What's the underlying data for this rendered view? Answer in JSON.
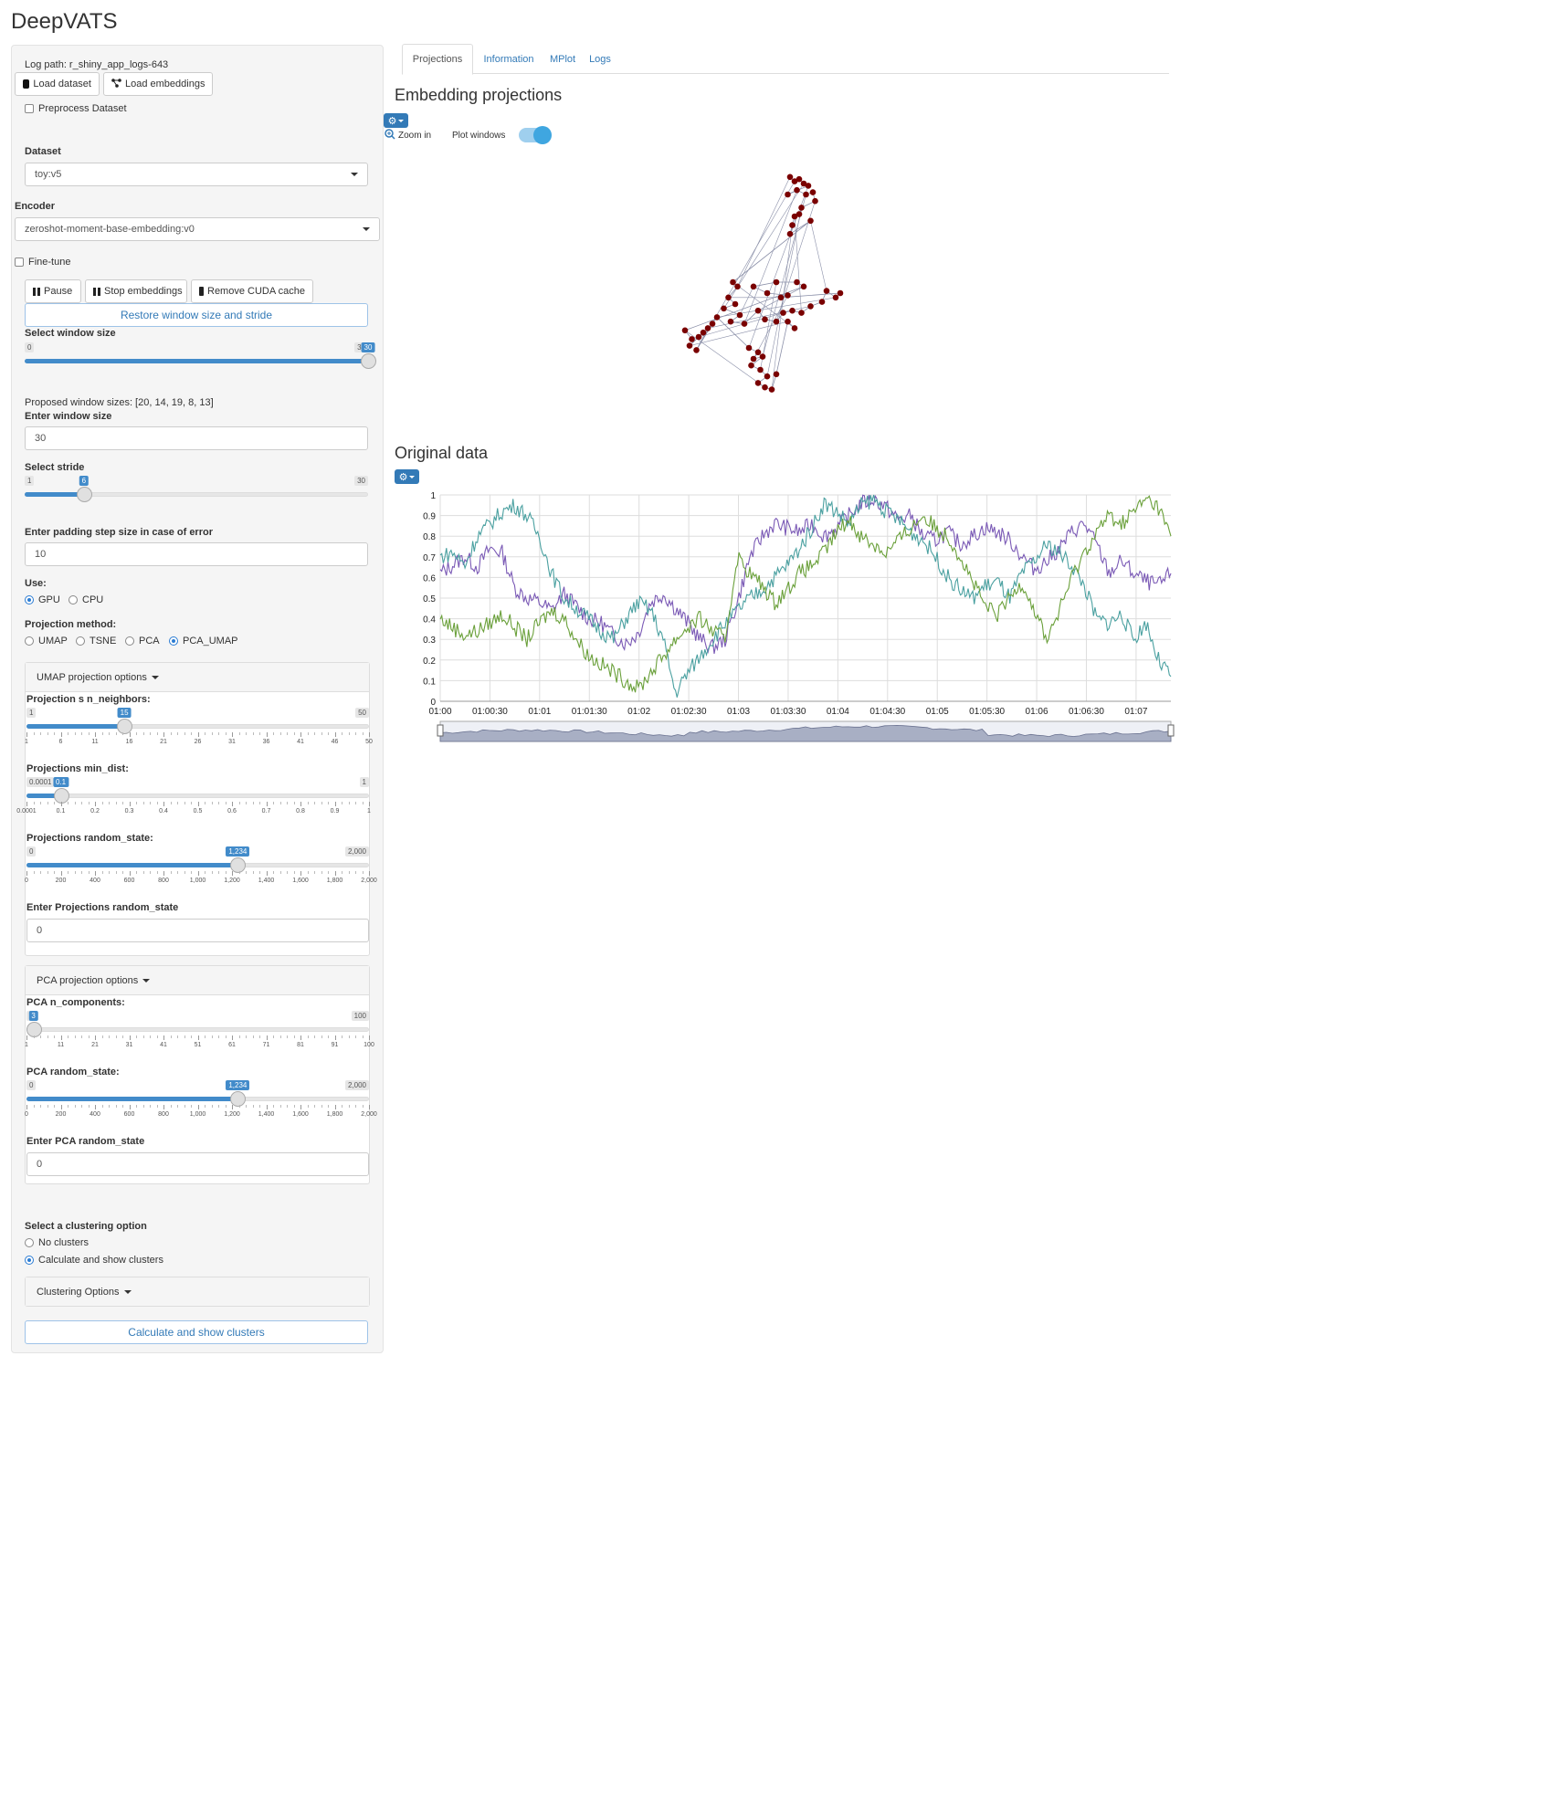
{
  "app_title": "DeepVATS",
  "sidebar": {
    "log_path": "Log path: r_shiny_app_logs-643",
    "load_dataset": "Load dataset",
    "load_embeddings": "Load embeddings",
    "preprocess_label": "Preprocess Dataset",
    "dataset_label": "Dataset",
    "dataset_value": "toy:v5",
    "encoder_label": "Encoder",
    "encoder_value": "zeroshot-moment-base-embedding:v0",
    "finetune_label": "Fine-tune",
    "pause": "Pause",
    "stop_embeddings": "Stop embeddings",
    "remove_cuda": "Remove CUDA cache",
    "restore_window": "Restore window size and stride",
    "window_size": {
      "label": "Select window size",
      "min": "0",
      "max": "30",
      "value": "30",
      "fraction": 1.0
    },
    "proposed_sizes": "Proposed window sizes: [20, 14, 19, 8, 13]",
    "enter_window_label": "Enter window size",
    "enter_window_value": "30",
    "stride": {
      "label": "Select stride",
      "min": "1",
      "max": "30",
      "value": "6",
      "fraction": 0.1724
    },
    "padding_label": "Enter padding step size in case of error",
    "padding_value": "10",
    "use_label": "Use:",
    "use_gpu": "GPU",
    "use_cpu": "CPU",
    "projection_label": "Projection method:",
    "proj_umap": "UMAP",
    "proj_tsne": "TSNE",
    "proj_pca": "PCA",
    "proj_pca_umap": "PCA_UMAP",
    "umap_panel": {
      "title": "UMAP projection options",
      "neighbors": {
        "label": "Projection s n_neighbors:",
        "min": "1",
        "max": "50",
        "value": "15",
        "fraction": 0.2857,
        "ticks": [
          "1",
          "6",
          "11",
          "16",
          "21",
          "26",
          "31",
          "36",
          "41",
          "46",
          "50"
        ]
      },
      "min_dist": {
        "label": "Projections min_dist:",
        "min": "0.0001",
        "max": "1",
        "value": "0.1",
        "fraction": 0.1,
        "ticks": [
          "0.0001",
          "0.1",
          "0.2",
          "0.3",
          "0.4",
          "0.5",
          "0.6",
          "0.7",
          "0.8",
          "0.9",
          "1"
        ]
      },
      "random_state": {
        "label": "Projections random_state:",
        "min": "0",
        "max": "2,000",
        "value": "1,234",
        "fraction": 0.617,
        "ticks": [
          "0",
          "200",
          "400",
          "600",
          "800",
          "1,000",
          "1,200",
          "1,400",
          "1,600",
          "1,800",
          "2,000"
        ]
      },
      "enter_label": "Enter Projections random_state",
      "enter_value": "0"
    },
    "pca_panel": {
      "title": "PCA projection options",
      "components": {
        "label": "PCA n_components:",
        "min": "1",
        "max": "100",
        "value": "3",
        "fraction": 0.0202,
        "ticks": [
          "1",
          "11",
          "21",
          "31",
          "41",
          "51",
          "61",
          "71",
          "81",
          "91",
          "100"
        ]
      },
      "random_state": {
        "label": "PCA random_state:",
        "min": "0",
        "max": "2,000",
        "value": "1,234",
        "fraction": 0.617,
        "ticks": [
          "0",
          "200",
          "400",
          "600",
          "800",
          "1,000",
          "1,200",
          "1,400",
          "1,600",
          "1,800",
          "2,000"
        ]
      },
      "enter_label": "Enter PCA random_state",
      "enter_value": "0"
    },
    "clustering_label": "Select a clustering option",
    "no_clusters": "No clusters",
    "calc_clusters": "Calculate and show clusters",
    "clustering_options": "Clustering Options",
    "calc_button": "Calculate and show clusters"
  },
  "tabs": [
    "Projections",
    "Information",
    "MPlot",
    "Logs"
  ],
  "main": {
    "embedding_title": "Embedding projections",
    "zoom_in": "Zoom in",
    "plot_windows": "Plot windows",
    "original_title": "Original data"
  },
  "colors": {
    "accent": "#337ab7",
    "slider": "#428bca",
    "point": "#7a0000",
    "series1": "#7a59b5",
    "series2": "#4aa0a0",
    "series3": "#6aa03a"
  },
  "chart_data": [
    {
      "type": "scatter",
      "title": "",
      "points": [
        [
          0.58,
          0.88
        ],
        [
          0.6,
          0.86
        ],
        [
          0.62,
          0.87
        ],
        [
          0.64,
          0.85
        ],
        [
          0.66,
          0.84
        ],
        [
          0.57,
          0.8
        ],
        [
          0.61,
          0.82
        ],
        [
          0.65,
          0.8
        ],
        [
          0.68,
          0.81
        ],
        [
          0.69,
          0.77
        ],
        [
          0.63,
          0.74
        ],
        [
          0.62,
          0.71
        ],
        [
          0.6,
          0.7
        ],
        [
          0.59,
          0.66
        ],
        [
          0.58,
          0.62
        ],
        [
          0.67,
          0.68
        ],
        [
          0.33,
          0.4
        ],
        [
          0.35,
          0.38
        ],
        [
          0.31,
          0.33
        ],
        [
          0.34,
          0.3
        ],
        [
          0.29,
          0.28
        ],
        [
          0.36,
          0.25
        ],
        [
          0.32,
          0.22
        ],
        [
          0.38,
          0.21
        ],
        [
          0.44,
          0.27
        ],
        [
          0.47,
          0.23
        ],
        [
          0.52,
          0.22
        ],
        [
          0.55,
          0.26
        ],
        [
          0.59,
          0.27
        ],
        [
          0.63,
          0.26
        ],
        [
          0.67,
          0.29
        ],
        [
          0.72,
          0.31
        ],
        [
          0.74,
          0.36
        ],
        [
          0.78,
          0.33
        ],
        [
          0.8,
          0.35
        ],
        [
          0.54,
          0.33
        ],
        [
          0.57,
          0.34
        ],
        [
          0.48,
          0.35
        ],
        [
          0.42,
          0.38
        ],
        [
          0.52,
          0.4
        ],
        [
          0.61,
          0.4
        ],
        [
          0.64,
          0.38
        ],
        [
          0.12,
          0.18
        ],
        [
          0.15,
          0.14
        ],
        [
          0.18,
          0.15
        ],
        [
          0.14,
          0.11
        ],
        [
          0.2,
          0.17
        ],
        [
          0.22,
          0.19
        ],
        [
          0.17,
          0.09
        ],
        [
          0.24,
          0.21
        ],
        [
          0.26,
          0.24
        ],
        [
          0.4,
          0.1
        ],
        [
          0.44,
          0.08
        ],
        [
          0.42,
          0.05
        ],
        [
          0.46,
          0.06
        ],
        [
          0.41,
          0.02
        ],
        [
          0.45,
          0.0
        ],
        [
          0.48,
          -0.03
        ],
        [
          0.44,
          -0.06
        ],
        [
          0.47,
          -0.08
        ],
        [
          0.5,
          -0.09
        ],
        [
          0.52,
          -0.02
        ],
        [
          0.57,
          0.22
        ],
        [
          0.6,
          0.19
        ]
      ]
    },
    {
      "type": "line",
      "title": "",
      "x_ticks": [
        "01:00",
        "01:00:30",
        "01:01",
        "01:01:30",
        "01:02",
        "01:02:30",
        "01:03",
        "01:03:30",
        "01:04",
        "01:04:30",
        "01:05",
        "01:05:30",
        "01:06",
        "01:06:30",
        "01:07"
      ],
      "y_ticks": [
        "0",
        "0.1",
        "0.2",
        "0.3",
        "0.4",
        "0.5",
        "0.6",
        "0.7",
        "0.8",
        "0.9",
        "1"
      ],
      "ylim": [
        0,
        1
      ],
      "series": [
        {
          "values": [
            0.62,
            0.66,
            0.7,
            0.65,
            0.74,
            0.72,
            0.55,
            0.5,
            0.48,
            0.44,
            0.52,
            0.46,
            0.4,
            0.38,
            0.32,
            0.28,
            0.33,
            0.48,
            0.52,
            0.45,
            0.38,
            0.3,
            0.26,
            0.3,
            0.48,
            0.7,
            0.8,
            0.86,
            0.84,
            0.82,
            0.86,
            0.8,
            0.84,
            0.9,
            0.96,
            0.98,
            0.94,
            0.88,
            0.9,
            0.8,
            0.78,
            0.82,
            0.76,
            0.8,
            0.84,
            0.82,
            0.78,
            0.7,
            0.64,
            0.68,
            0.74,
            0.82,
            0.86,
            0.76,
            0.62,
            0.68,
            0.62,
            0.58,
            0.56,
            0.62
          ]
        },
        {
          "values": [
            0.7,
            0.72,
            0.66,
            0.8,
            0.86,
            0.92,
            0.95,
            0.9,
            0.8,
            0.62,
            0.5,
            0.45,
            0.4,
            0.34,
            0.3,
            0.4,
            0.48,
            0.44,
            0.3,
            0.04,
            0.14,
            0.22,
            0.3,
            0.38,
            0.44,
            0.5,
            0.54,
            0.6,
            0.66,
            0.74,
            0.84,
            0.96,
            0.92,
            0.86,
            0.95,
            0.98,
            0.92,
            0.88,
            0.82,
            0.78,
            0.7,
            0.6,
            0.54,
            0.5,
            0.56,
            0.58,
            0.5,
            0.62,
            0.68,
            0.76,
            0.72,
            0.66,
            0.56,
            0.4,
            0.38,
            0.42,
            0.3,
            0.38,
            0.2,
            0.12
          ]
        },
        {
          "values": [
            0.4,
            0.36,
            0.32,
            0.34,
            0.38,
            0.42,
            0.36,
            0.3,
            0.38,
            0.44,
            0.4,
            0.3,
            0.22,
            0.18,
            0.14,
            0.1,
            0.06,
            0.14,
            0.22,
            0.3,
            0.36,
            0.4,
            0.34,
            0.3,
            0.7,
            0.62,
            0.56,
            0.48,
            0.54,
            0.62,
            0.66,
            0.72,
            0.82,
            0.88,
            0.8,
            0.76,
            0.72,
            0.78,
            0.84,
            0.9,
            0.84,
            0.8,
            0.7,
            0.58,
            0.46,
            0.42,
            0.5,
            0.58,
            0.44,
            0.3,
            0.44,
            0.6,
            0.72,
            0.82,
            0.9,
            0.86,
            0.92,
            0.98,
            0.94,
            0.8
          ]
        }
      ]
    }
  ]
}
